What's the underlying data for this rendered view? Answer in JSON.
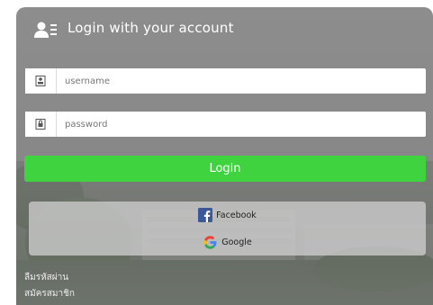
{
  "header": {
    "title": "Login with your account",
    "icon": "user-list-icon"
  },
  "form": {
    "username_placeholder": "username",
    "password_placeholder": "password",
    "username_icon": "id-card-icon",
    "password_icon": "lock-icon"
  },
  "login_button": {
    "label": "Login",
    "color": "#3fd33f"
  },
  "social": {
    "facebook_label": "Facebook",
    "google_label": "Google"
  },
  "links": {
    "forgot_password": "ลืมรหัสผ่าน",
    "register": "สมัครสมาชิก"
  },
  "colors": {
    "panel_bg": "#8a8a8a",
    "facebook_blue": "#3b5998"
  }
}
